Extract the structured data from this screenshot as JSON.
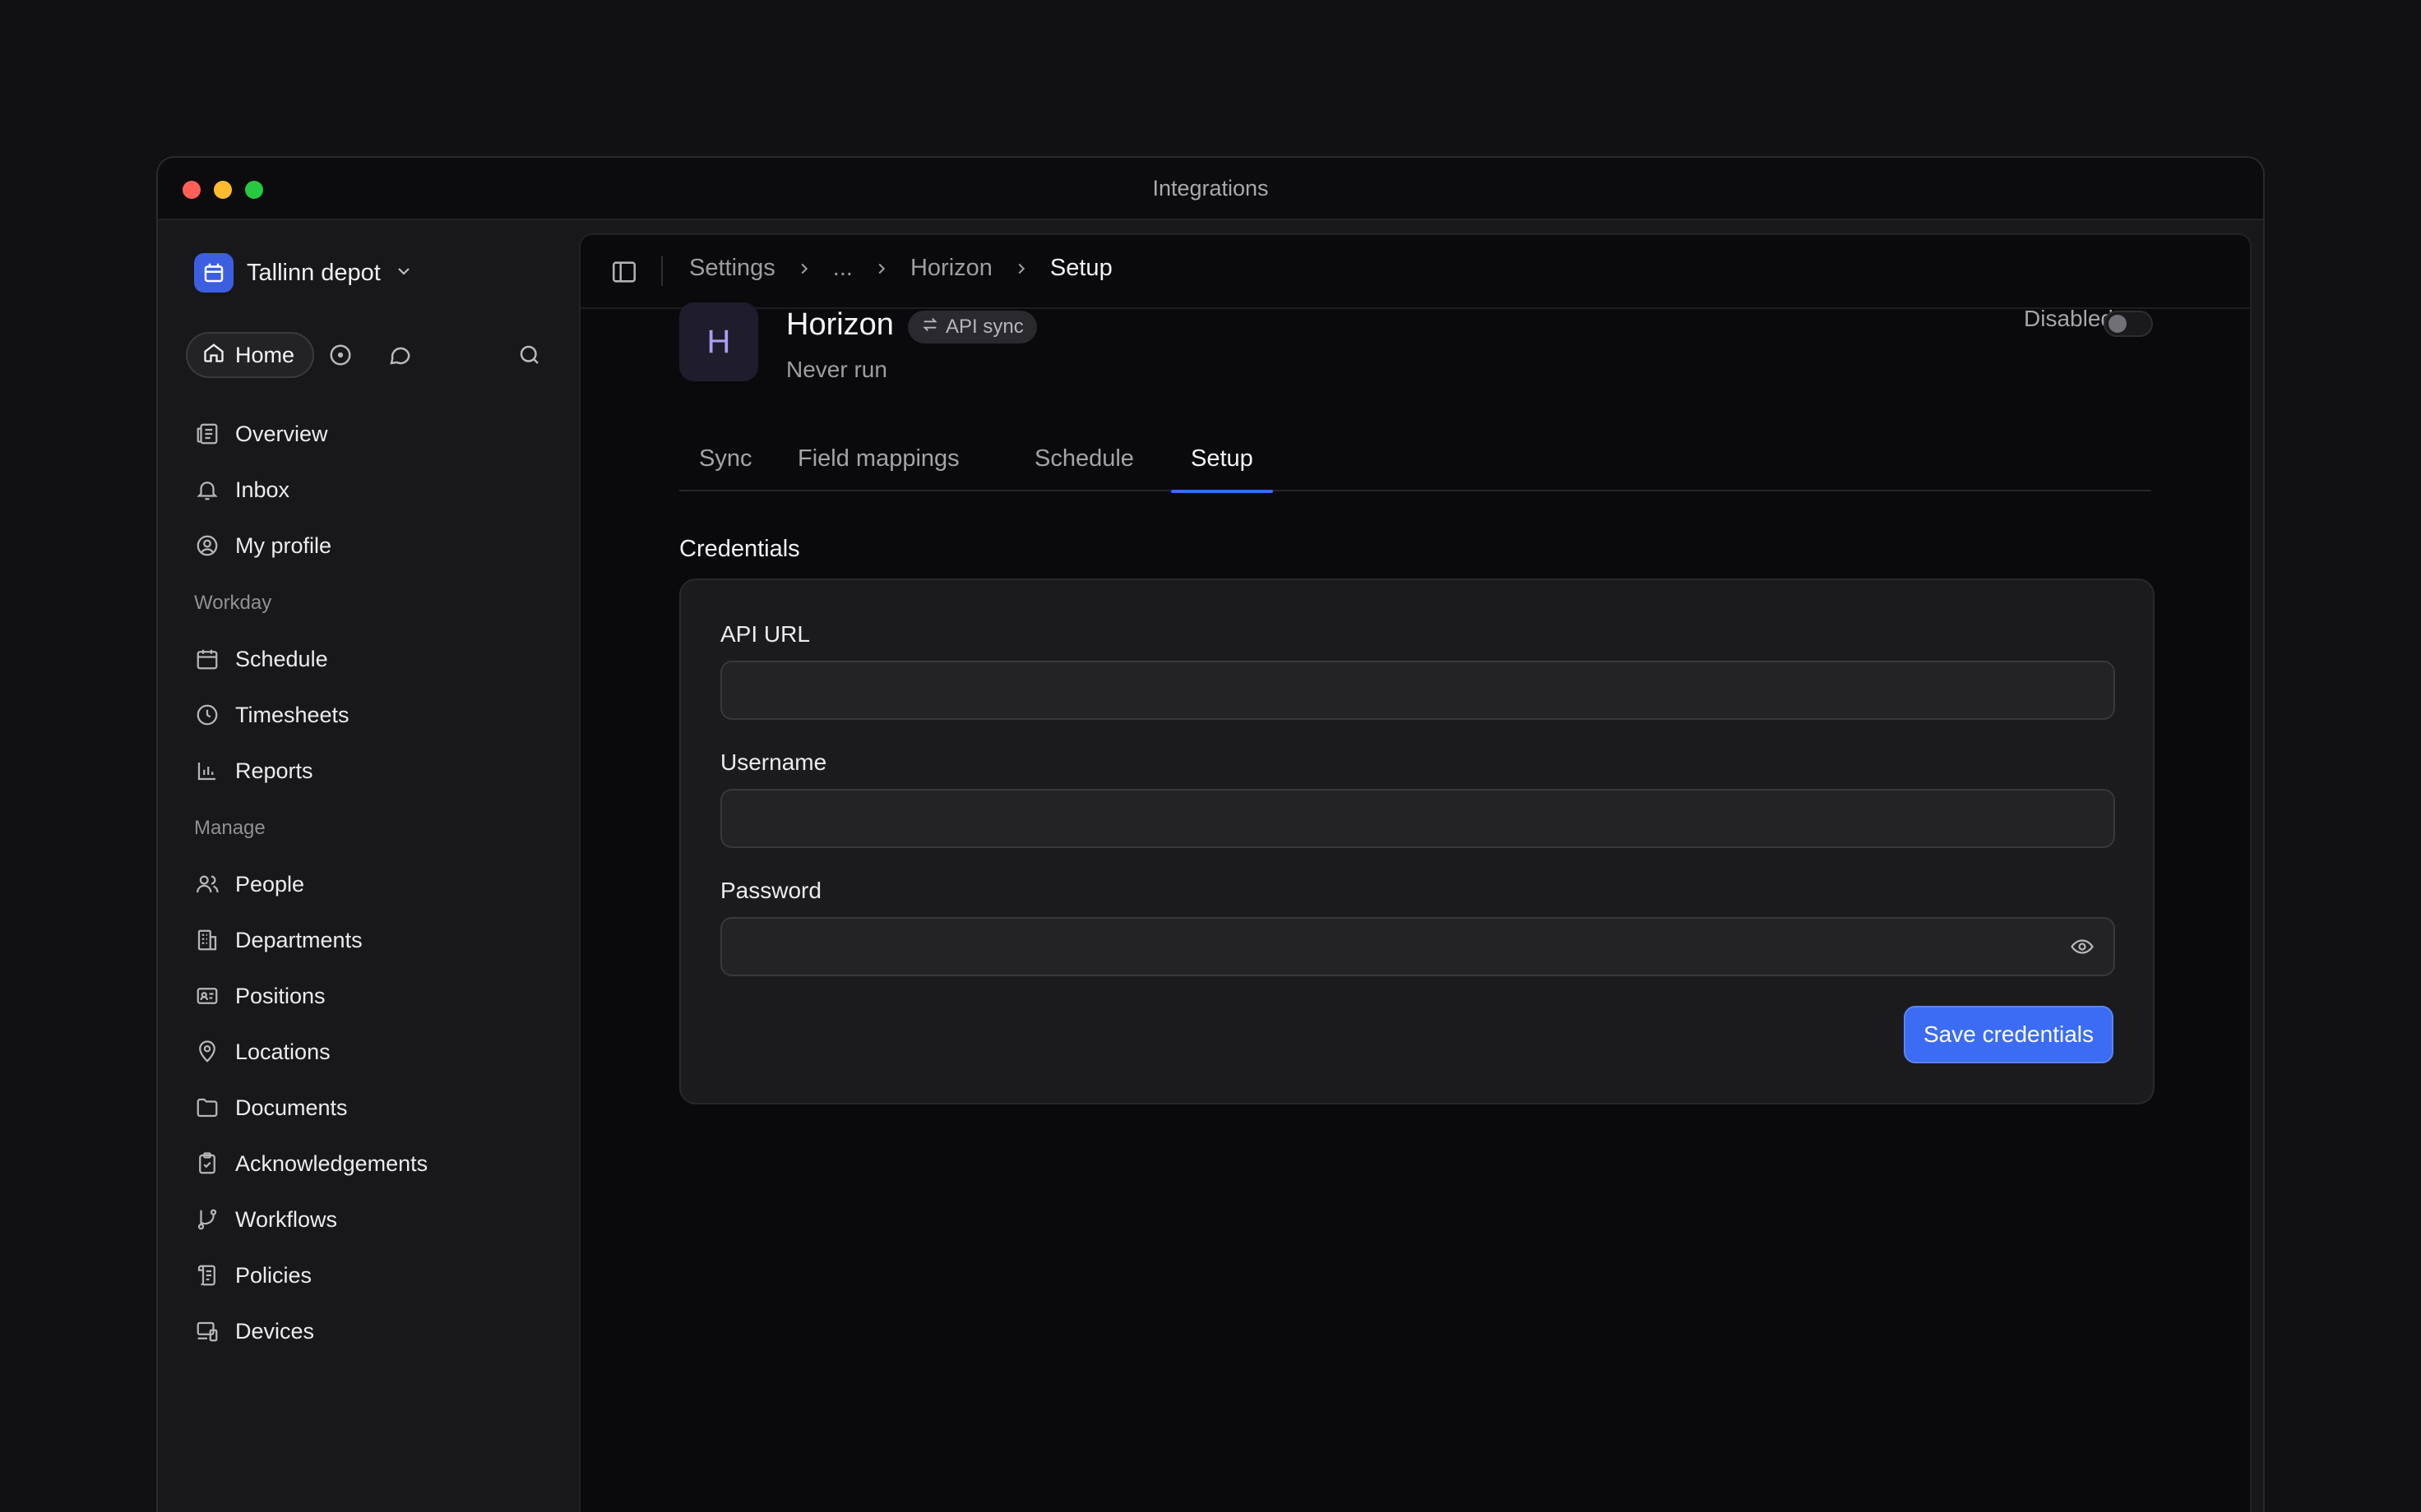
{
  "window": {
    "title": "Integrations"
  },
  "workspace": {
    "name": "Tallinn depot"
  },
  "quick": {
    "home_label": "Home"
  },
  "nav": {
    "main": [
      {
        "label": "Overview",
        "icon": "newspaper-icon"
      },
      {
        "label": "Inbox",
        "icon": "bell-icon"
      },
      {
        "label": "My profile",
        "icon": "user-circle-icon"
      }
    ],
    "workday_title": "Workday",
    "workday": [
      {
        "label": "Schedule",
        "icon": "calendar-icon"
      },
      {
        "label": "Timesheets",
        "icon": "clock-icon"
      },
      {
        "label": "Reports",
        "icon": "bar-chart-icon"
      }
    ],
    "manage_title": "Manage",
    "manage": [
      {
        "label": "People",
        "icon": "users-icon"
      },
      {
        "label": "Departments",
        "icon": "building-icon"
      },
      {
        "label": "Positions",
        "icon": "id-card-icon"
      },
      {
        "label": "Locations",
        "icon": "map-pin-icon"
      },
      {
        "label": "Documents",
        "icon": "folder-icon"
      },
      {
        "label": "Acknowledgements",
        "icon": "clipboard-check-icon"
      },
      {
        "label": "Workflows",
        "icon": "git-branch-icon"
      },
      {
        "label": "Policies",
        "icon": "scroll-icon"
      },
      {
        "label": "Devices",
        "icon": "devices-icon"
      }
    ]
  },
  "breadcrumb": [
    "Settings",
    "...",
    "Horizon",
    "Setup"
  ],
  "integration": {
    "initial": "H",
    "name": "Horizon",
    "badge": "API sync",
    "last_run": "Never run",
    "status_label": "Disabled",
    "enabled": false
  },
  "tabs": [
    {
      "label": "Sync",
      "active": false
    },
    {
      "label": "Field mappings",
      "active": false
    },
    {
      "label": "Schedule",
      "active": false
    },
    {
      "label": "Setup",
      "active": true
    }
  ],
  "credentials": {
    "title": "Credentials",
    "api_url": {
      "label": "API URL",
      "value": ""
    },
    "username": {
      "label": "Username",
      "value": ""
    },
    "password": {
      "label": "Password",
      "value": ""
    },
    "save_label": "Save credentials"
  },
  "colors": {
    "accent": "#3b6cf3",
    "background": "#0a0a0c",
    "sidebar": "#18181a"
  }
}
